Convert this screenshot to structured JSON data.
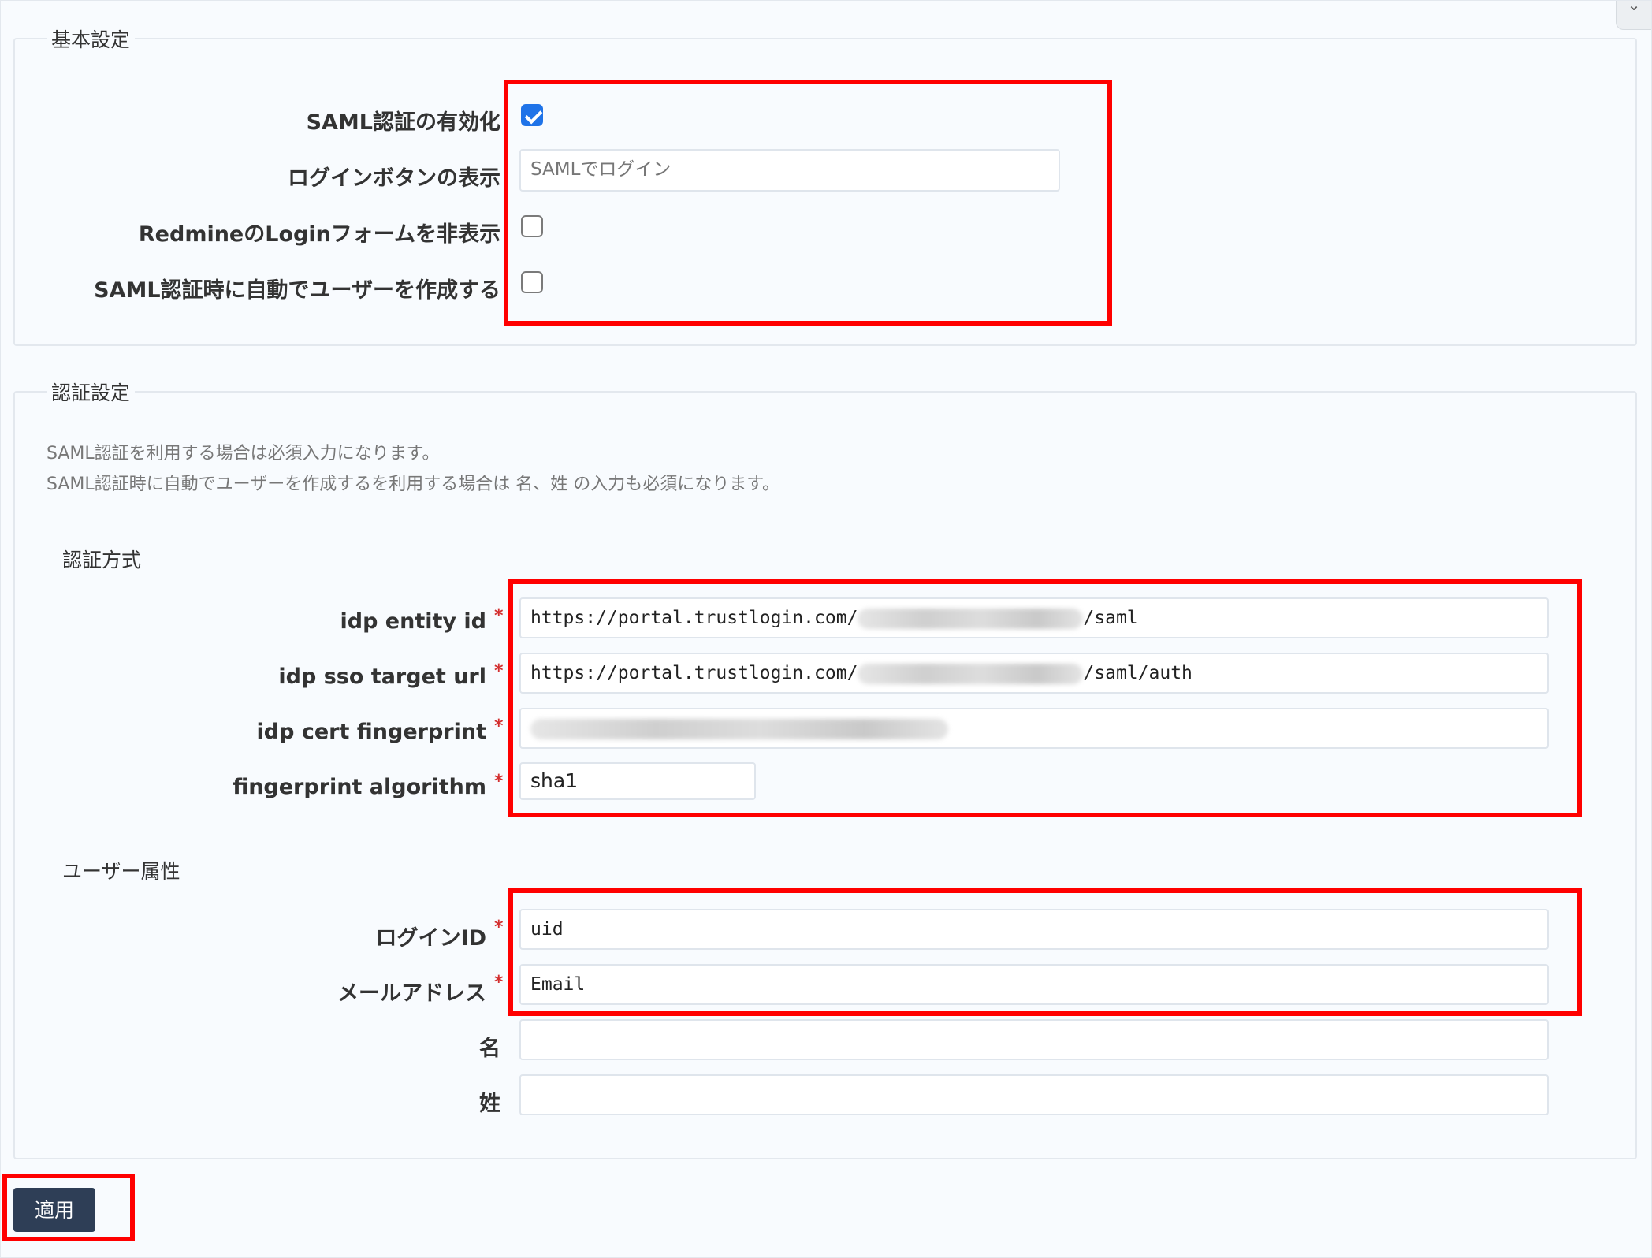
{
  "corner": {
    "icon": "chevron-icon",
    "glyph": "⌄"
  },
  "basic": {
    "legend": "基本設定",
    "enable_saml_label": "SAML認証の有効化",
    "enable_saml_checked": true,
    "login_button_label": "ログインボタンの表示",
    "login_button_placeholder": "SAMLでログイン",
    "hide_login_form_label": "RedmineのLoginフォームを非表示",
    "hide_login_form_checked": false,
    "auto_create_user_label": "SAML認証時に自動でユーザーを作成する",
    "auto_create_user_checked": false
  },
  "auth": {
    "legend": "認証設定",
    "help_line1": "SAML認証を利用する場合は必須入力になります。",
    "help_line2": "SAML認証時に自動でユーザーを作成するを利用する場合は 名、姓 の入力も必須になります。",
    "method_heading": "認証方式",
    "required_mark": "*",
    "idp_entity_id_label": "idp entity id",
    "idp_entity_id_prefix": "https://portal.trustlogin.com/",
    "idp_entity_id_suffix": "/saml",
    "idp_sso_target_url_label": "idp sso target url",
    "idp_sso_target_url_prefix": "https://portal.trustlogin.com/",
    "idp_sso_target_url_suffix": "/saml/auth",
    "idp_cert_fingerprint_label": "idp cert fingerprint",
    "fingerprint_algorithm_label": "fingerprint algorithm",
    "fingerprint_algorithm_value": "sha1",
    "attributes_heading": "ユーザー属性",
    "login_id_label": "ログインID",
    "login_id_value": "uid",
    "email_label": "メールアドレス",
    "email_value": "Email",
    "firstname_label": "名",
    "firstname_value": "",
    "lastname_label": "姓",
    "lastname_value": ""
  },
  "actions": {
    "apply_label": "適用"
  },
  "highlight_color": "#ff0000",
  "checkbox_accent": "#1f73e8",
  "button_color": "#2e3e56"
}
